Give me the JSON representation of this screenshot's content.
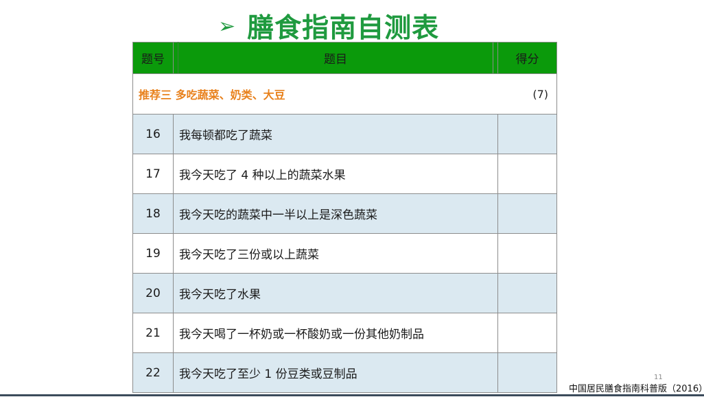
{
  "title": {
    "arrow": "➢",
    "text": "膳食指南自测表"
  },
  "table": {
    "headers": {
      "number": "题号",
      "item": "题目",
      "score": "得分"
    },
    "section": {
      "title": "推荐三  多吃蔬菜、奶类、大豆",
      "score": "(7)"
    },
    "rows": [
      {
        "no": "16",
        "text": "我每顿都吃了蔬菜"
      },
      {
        "no": "17",
        "text": "我今天吃了 4 种以上的蔬菜水果"
      },
      {
        "no": "18",
        "text": "我今天吃的蔬菜中一半以上是深色蔬菜"
      },
      {
        "no": "19",
        "text": "我今天吃了三份或以上蔬菜"
      },
      {
        "no": "20",
        "text": "我今天吃了水果"
      },
      {
        "no": "21",
        "text": "我今天喝了一杯奶或一杯酸奶或一份其他奶制品"
      },
      {
        "no": "22",
        "text": "我今天吃了至少 1 份豆类或豆制品"
      }
    ]
  },
  "footer": {
    "page_number": "11",
    "source": "中国居民膳食指南科普版（2016）"
  },
  "colors": {
    "title_green": "#1f9a3f",
    "header_green": "#0b9a0b",
    "section_orange": "#e8811c",
    "row_shade": "#dbe9f1"
  }
}
